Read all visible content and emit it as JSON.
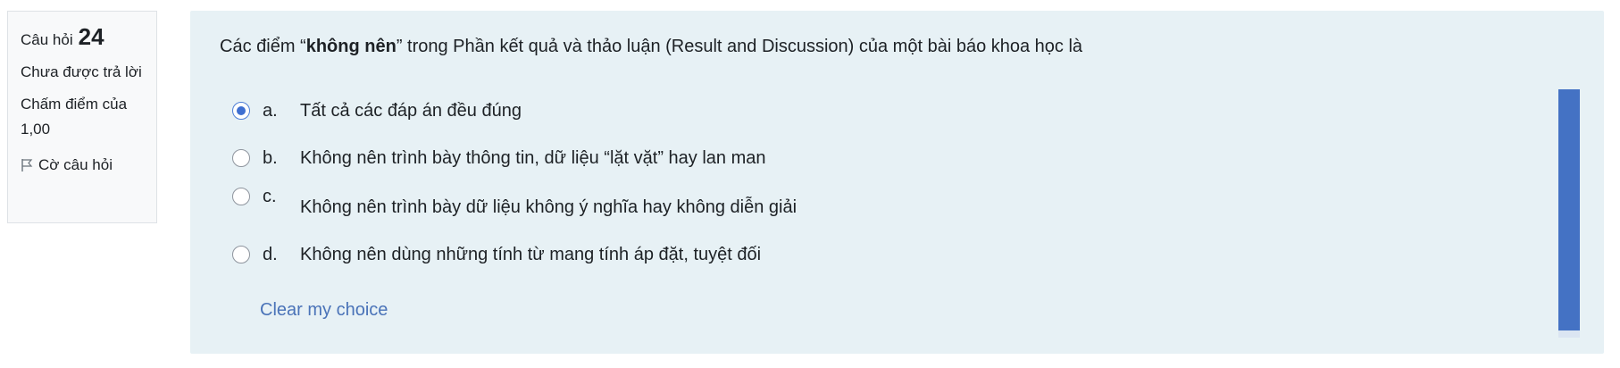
{
  "info": {
    "question_label": "Câu hỏi",
    "question_number": "24",
    "state": "Chưa được trả lời",
    "grade": "Chấm điểm của 1,00",
    "flag_label": "Cờ câu hỏi"
  },
  "question": {
    "text_before": "Các điểm “",
    "text_bold": "không nên",
    "text_after": "” trong Phần kết quả và thảo luận (Result and Discussion) của một bài báo khoa học là",
    "selected_option": "a",
    "options": [
      {
        "letter": "a.",
        "text": "Tất cả các đáp án đều đúng"
      },
      {
        "letter": "b.",
        "text": "Không nên trình bày thông tin, dữ liệu “lặt vặt” hay lan man"
      },
      {
        "letter": "c.",
        "text": "Không nên trình bày dữ liệu không ý nghĩa hay không diễn giải"
      },
      {
        "letter": "d.",
        "text": "Không nên dùng những tính từ mang tính áp đặt, tuyệt đối"
      }
    ],
    "clear_label": "Clear my choice"
  },
  "colors": {
    "panel_background": "#e7f1f5",
    "link": "#4a73b8",
    "radio_selected": "#3e6fd1",
    "scroll_thumb": "#4472c4"
  },
  "icons": {
    "flag": "flag-icon"
  }
}
